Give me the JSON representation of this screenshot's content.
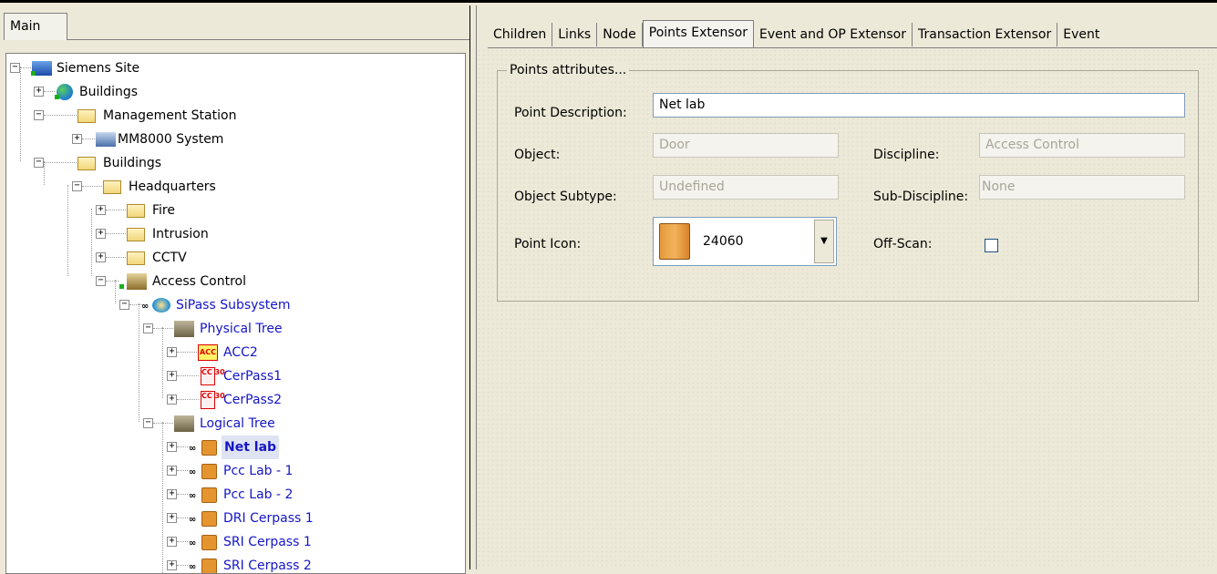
{
  "left": {
    "tab_main": "Main"
  },
  "tree": {
    "siemens_site": "Siemens Site",
    "buildings_top": "Buildings",
    "management_station": "Management Station",
    "mm8000": "MM8000 System",
    "buildings": "Buildings",
    "headquarters": "Headquarters",
    "fire": "Fire",
    "intrusion": "Intrusion",
    "cctv": "CCTV",
    "access_control": "Access Control",
    "sipass": "SiPass Subsystem",
    "physical_tree": "Physical Tree",
    "acc2": "ACC2",
    "cerpass1": "CerPass1",
    "cerpass2": "CerPass2",
    "logical_tree": "Logical Tree",
    "net_lab": "Net lab",
    "pcc_lab_1": "Pcc Lab - 1",
    "pcc_lab_2": "Pcc Lab - 2",
    "dri_cerpass_1": "DRI Cerpass 1",
    "sri_cerpass_1": "SRI Cerpass 1",
    "sri_cerpass_2": "SRI Cerpass 2",
    "acc_badge": "ACC",
    "cc_badge": "CC 30",
    "inf_badge": "∞"
  },
  "tabs": {
    "children": "Children",
    "links": "Links",
    "node": "Node",
    "points_extensor": "Points Extensor",
    "event_op_extensor": "Event and OP Extensor",
    "transaction_extensor": "Transaction Extensor",
    "event": "Event"
  },
  "points": {
    "group_title": "Points attributes...",
    "point_description_label": "Point Description:",
    "point_description_value": "Net lab",
    "object_label": "Object:",
    "object_value": "Door",
    "discipline_label": "Discipline:",
    "discipline_value": "Access Control",
    "object_subtype_label": "Object Subtype:",
    "object_subtype_value": "Undefined",
    "sub_discipline_label": "Sub-Discipline:",
    "sub_discipline_value": "None",
    "point_icon_label": "Point Icon:",
    "point_icon_value": "24060",
    "off_scan_label": "Off-Scan:",
    "off_scan_checked": false
  },
  "icons": {
    "expand": "+",
    "collapse": "−",
    "dropdown": "▼"
  }
}
